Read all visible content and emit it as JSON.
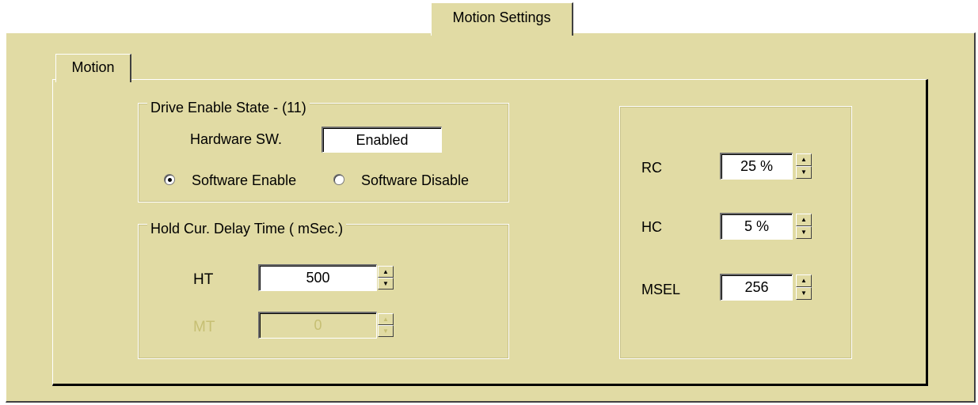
{
  "tabs": {
    "outer_label": "Motion Settings",
    "inner_label": "Motion"
  },
  "drive_enable": {
    "legend": "Drive Enable State  - (11)",
    "hardware_label": "Hardware SW.",
    "hardware_value": "Enabled",
    "radio_options": [
      {
        "label": "Software Enable",
        "selected": true
      },
      {
        "label": "Software Disable",
        "selected": false
      }
    ]
  },
  "hold_delay": {
    "legend": "Hold Cur. Delay Time ( mSec.)",
    "ht_label": "HT",
    "ht_value": "500",
    "mt_label": "MT",
    "mt_value": "0",
    "mt_enabled": false
  },
  "current_settings": {
    "rc_label": "RC",
    "rc_value": "25 %",
    "hc_label": "HC",
    "hc_value": "5 %",
    "msel_label": "MSEL",
    "msel_value": "256"
  },
  "icons": {
    "spin_up": "▲",
    "spin_down": "▼"
  },
  "colors": {
    "panel_bg": "#e1dba4",
    "disabled_text": "#c6bf73"
  }
}
